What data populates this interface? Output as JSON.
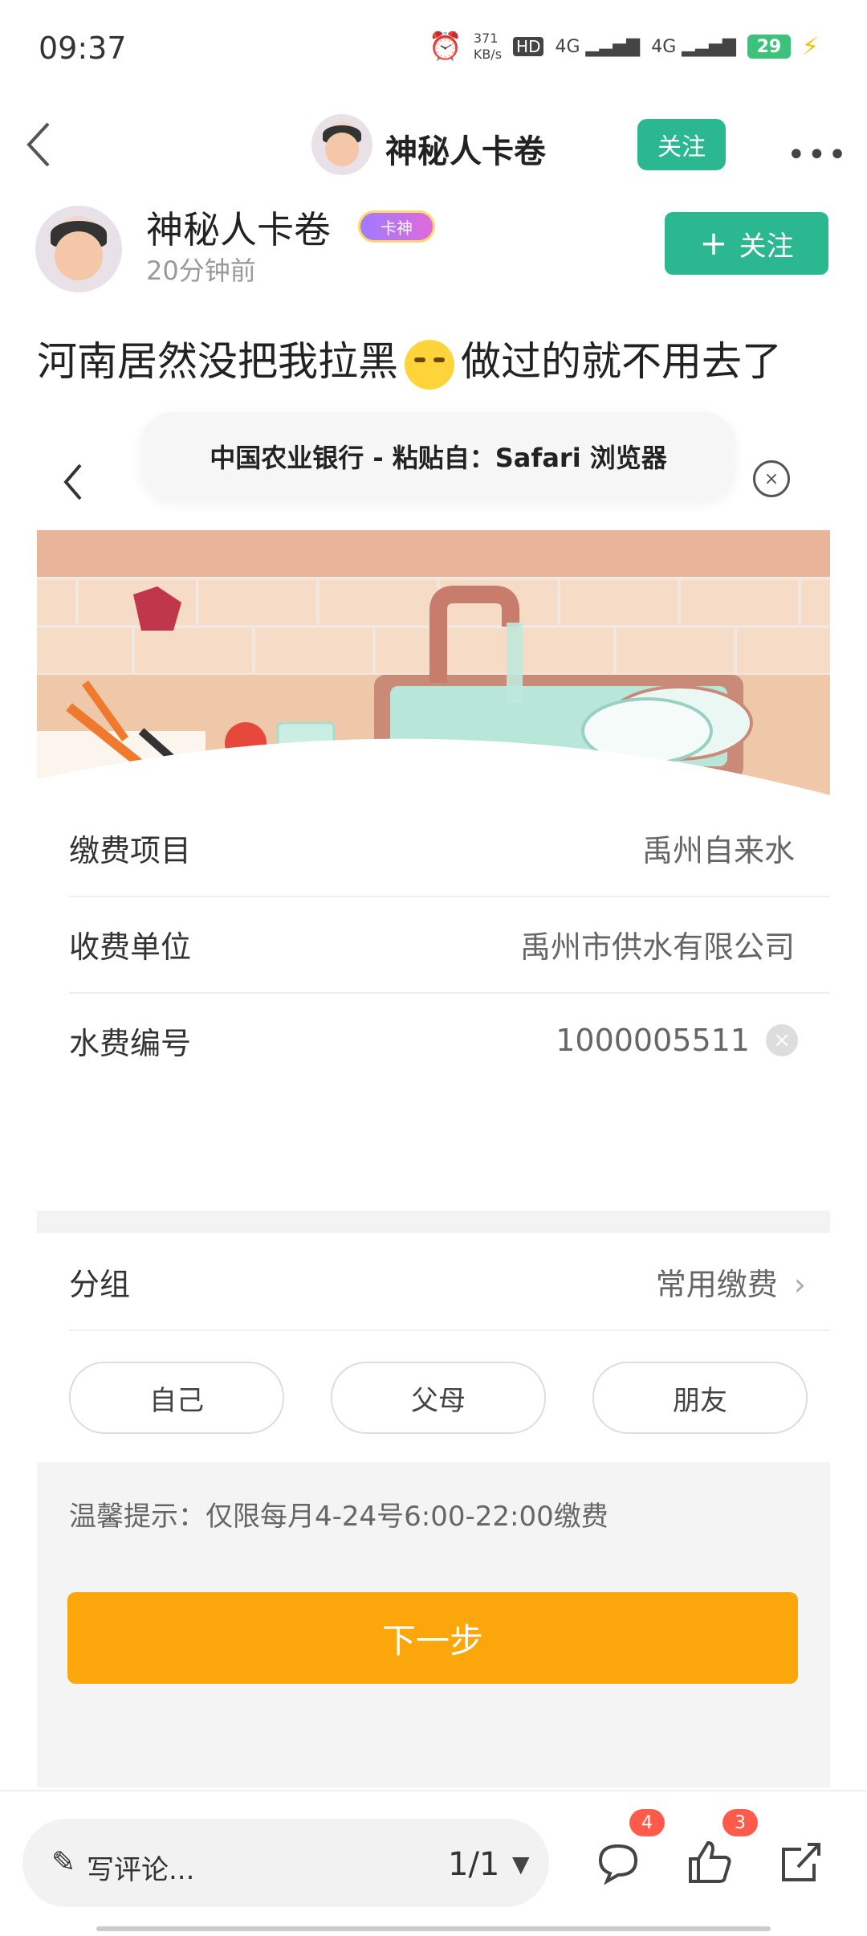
{
  "status": {
    "time": "09:37",
    "net_speed": "371",
    "net_unit": "KB/s",
    "hd": "HD",
    "sig1": "4G",
    "sig2": "4G",
    "battery": "29"
  },
  "nav": {
    "title": "神秘人卡卷",
    "follow": "关注"
  },
  "post": {
    "author": "神秘人卡卷",
    "badge": "卡神",
    "time": "20分钟前",
    "follow": "关注",
    "text_before": "河南居然没把我拉黑",
    "text_after": "做过的就不用去了"
  },
  "screenshot": {
    "pill_text": "中国农业银行 - 粘贴自：Safari 浏览器",
    "rows": [
      {
        "label": "缴费项目",
        "value": "禹州自来水"
      },
      {
        "label": "收费单位",
        "value": "禹州市供水有限公司"
      },
      {
        "label": "水费编号",
        "value": "1000005511"
      }
    ],
    "group_label": "分组",
    "group_value": "常用缴费",
    "chips": [
      "自己",
      "父母",
      "朋友"
    ],
    "tip": "温馨提示：仅限每月4-24号6:00-22:00缴费",
    "next": "下一步"
  },
  "bottom": {
    "comment_placeholder": "写评论...",
    "page": "1/1",
    "comment_count": "4",
    "like_count": "3"
  },
  "colors": {
    "accent_green": "#2bb891",
    "orange": "#fba70b",
    "badge_red": "#ff5a4a"
  }
}
